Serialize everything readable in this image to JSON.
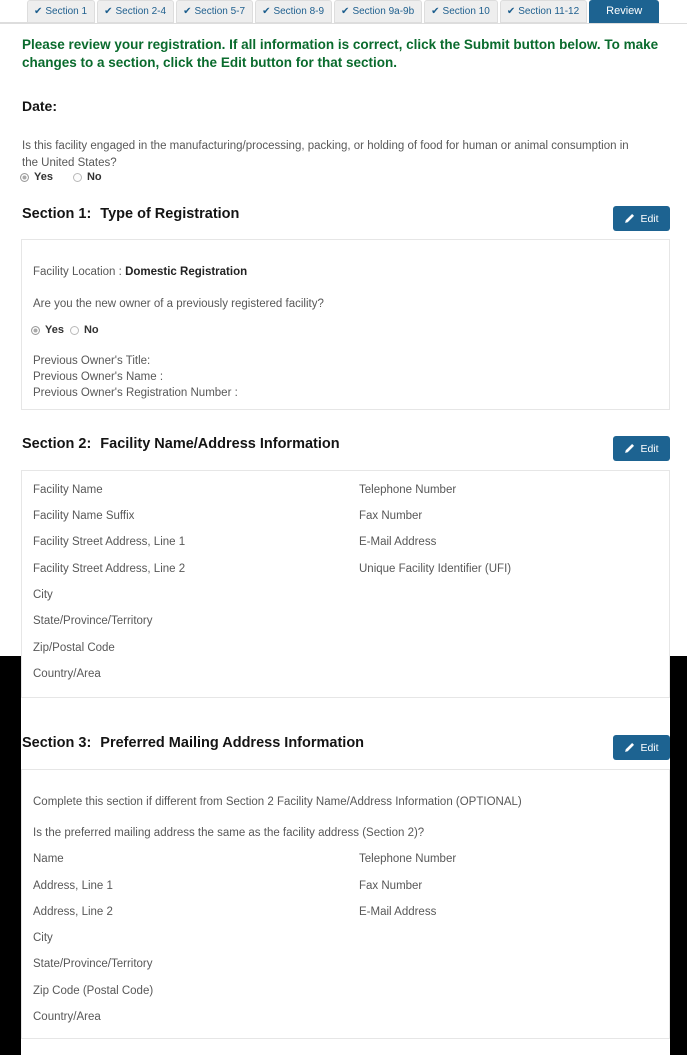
{
  "tabs": [
    {
      "label": "Section 1",
      "checked": true,
      "active": false
    },
    {
      "label": "Section 2-4",
      "checked": true,
      "active": false
    },
    {
      "label": "Section 5-7",
      "checked": true,
      "active": false
    },
    {
      "label": "Section 8-9",
      "checked": true,
      "active": false
    },
    {
      "label": "Section 9a-9b",
      "checked": true,
      "active": false
    },
    {
      "label": "Section 10",
      "checked": true,
      "active": false
    },
    {
      "label": "Section 11-12",
      "checked": true,
      "active": false
    },
    {
      "label": "Review",
      "checked": false,
      "active": true
    }
  ],
  "intro": {
    "text": "Please review your registration. If all information is correct, click the Submit button below. To make changes to a section, click the Edit button for that section."
  },
  "date": {
    "label": "Date:",
    "value": ""
  },
  "top_question": {
    "text": "Is this facility engaged in the manufacturing/processing, packing, or holding of food for human or animal consumption in the United States?",
    "options": [
      {
        "label": "Yes",
        "selected": true
      },
      {
        "label": "No",
        "selected": false
      }
    ]
  },
  "edit_label": "Edit",
  "section1": {
    "number": "Section 1:",
    "title": "Type of Registration",
    "facility_location_label": "Facility Location :",
    "facility_location_value": "Domestic Registration",
    "owner_question": "Are you the new owner of a previously registered facility?",
    "owner_options": [
      {
        "label": "Yes",
        "selected": true
      },
      {
        "label": "No",
        "selected": false
      }
    ],
    "prev_owner_title": "Previous Owner's Title:",
    "prev_owner_name": "Previous Owner's Name :",
    "prev_owner_reg": "Previous Owner's Registration Number :"
  },
  "section2": {
    "number": "Section 2:",
    "title": "Facility Name/Address Information",
    "left_fields": [
      "Facility Name",
      "Facility Name Suffix",
      "Facility Street Address, Line 1",
      "Facility Street Address, Line 2",
      "City",
      "State/Province/Territory",
      "Zip/Postal Code",
      "Country/Area"
    ],
    "right_fields": [
      "Telephone Number",
      "Fax Number",
      "E-Mail Address",
      "Unique Facility Identifier (UFI)"
    ]
  },
  "section3": {
    "number": "Section 3:",
    "title": "Preferred Mailing Address Information",
    "note": "Complete this section if different from Section 2 Facility Name/Address Information (OPTIONAL)",
    "question": "Is the preferred mailing address the same as the facility address (Section 2)?",
    "left_fields": [
      "Name",
      "Address, Line 1",
      "Address, Line 2",
      "City",
      "State/Province/Territory",
      "Zip Code (Postal Code)",
      "Country/Area"
    ],
    "right_fields": [
      "Telephone Number",
      "Fax Number",
      "E-Mail Address"
    ]
  },
  "colors": {
    "accent": "#1d6391",
    "tab_text": "#1e5f8e",
    "intro_green": "#0a6b2d",
    "label_gray": "#585858",
    "band_black": "#000000"
  }
}
